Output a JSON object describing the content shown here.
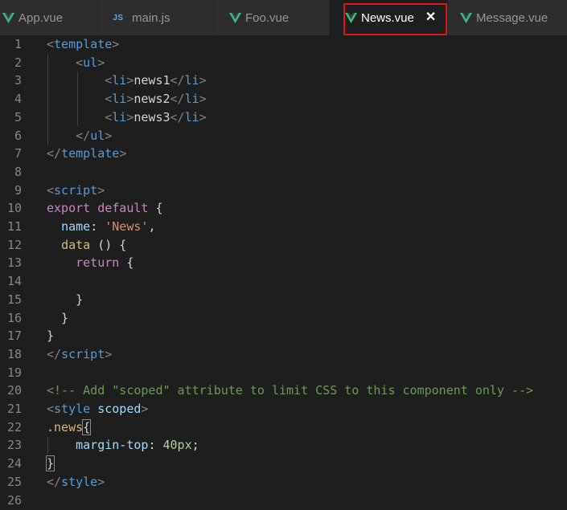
{
  "tabs": [
    {
      "label": "App.vue",
      "icon": "vue-icon",
      "active": false
    },
    {
      "label": "main.js",
      "icon": "js-icon",
      "icon_text": "JS",
      "active": false
    },
    {
      "label": "Foo.vue",
      "icon": "vue-icon",
      "active": false
    },
    {
      "label": "News.vue",
      "icon": "vue-icon",
      "active": true,
      "close": "✕"
    },
    {
      "label": "Message.vue",
      "icon": "vue-icon",
      "active": false
    }
  ],
  "colors": {
    "vue_green": "#41b883",
    "highlight_red": "#e0131a",
    "editor_bg": "#1e1e1e"
  },
  "code_lines": [
    {
      "n": "1",
      "tokens": [
        [
          "punct",
          "<"
        ],
        [
          "tag",
          "template"
        ],
        [
          "punct",
          ">"
        ]
      ]
    },
    {
      "n": "2",
      "tokens": [
        [
          "text",
          "    "
        ],
        [
          "punct",
          "<"
        ],
        [
          "tag",
          "ul"
        ],
        [
          "punct",
          ">"
        ]
      ]
    },
    {
      "n": "3",
      "tokens": [
        [
          "text",
          "        "
        ],
        [
          "punct",
          "<"
        ],
        [
          "tag",
          "li"
        ],
        [
          "punct",
          ">"
        ],
        [
          "text",
          "news1"
        ],
        [
          "punct",
          "</"
        ],
        [
          "tag",
          "li"
        ],
        [
          "punct",
          ">"
        ]
      ]
    },
    {
      "n": "4",
      "tokens": [
        [
          "text",
          "        "
        ],
        [
          "punct",
          "<"
        ],
        [
          "tag",
          "li"
        ],
        [
          "punct",
          ">"
        ],
        [
          "text",
          "news2"
        ],
        [
          "punct",
          "</"
        ],
        [
          "tag",
          "li"
        ],
        [
          "punct",
          ">"
        ]
      ]
    },
    {
      "n": "5",
      "tokens": [
        [
          "text",
          "        "
        ],
        [
          "punct",
          "<"
        ],
        [
          "tag",
          "li"
        ],
        [
          "punct",
          ">"
        ],
        [
          "text",
          "news3"
        ],
        [
          "punct",
          "</"
        ],
        [
          "tag",
          "li"
        ],
        [
          "punct",
          ">"
        ]
      ]
    },
    {
      "n": "6",
      "tokens": [
        [
          "text",
          "    "
        ],
        [
          "punct",
          "</"
        ],
        [
          "tag",
          "ul"
        ],
        [
          "punct",
          ">"
        ]
      ]
    },
    {
      "n": "7",
      "tokens": [
        [
          "punct",
          "</"
        ],
        [
          "tag",
          "template"
        ],
        [
          "punct",
          ">"
        ]
      ]
    },
    {
      "n": "8",
      "tokens": []
    },
    {
      "n": "9",
      "tokens": [
        [
          "punct",
          "<"
        ],
        [
          "tag",
          "script"
        ],
        [
          "punct",
          ">"
        ]
      ]
    },
    {
      "n": "10",
      "tokens": [
        [
          "kw",
          "export"
        ],
        [
          "text",
          " "
        ],
        [
          "kw",
          "default"
        ],
        [
          "text",
          " {"
        ]
      ]
    },
    {
      "n": "11",
      "tokens": [
        [
          "text",
          "  "
        ],
        [
          "prop",
          "name"
        ],
        [
          "text",
          ": "
        ],
        [
          "str",
          "'News'"
        ],
        [
          "text",
          ","
        ]
      ]
    },
    {
      "n": "12",
      "tokens": [
        [
          "text",
          "  "
        ],
        [
          "sel",
          "data"
        ],
        [
          "text",
          " () {"
        ]
      ]
    },
    {
      "n": "13",
      "tokens": [
        [
          "text",
          "    "
        ],
        [
          "kw",
          "return"
        ],
        [
          "text",
          " {"
        ]
      ]
    },
    {
      "n": "14",
      "tokens": []
    },
    {
      "n": "15",
      "tokens": [
        [
          "text",
          "    }"
        ]
      ]
    },
    {
      "n": "16",
      "tokens": [
        [
          "text",
          "  }"
        ]
      ]
    },
    {
      "n": "17",
      "tokens": [
        [
          "text",
          "}"
        ]
      ]
    },
    {
      "n": "18",
      "tokens": [
        [
          "punct",
          "</"
        ],
        [
          "tag",
          "script"
        ],
        [
          "punct",
          ">"
        ]
      ]
    },
    {
      "n": "19",
      "tokens": []
    },
    {
      "n": "20",
      "tokens": [
        [
          "comment",
          "<!-- Add \"scoped\" attribute to limit CSS to this component only -->"
        ]
      ]
    },
    {
      "n": "21",
      "tokens": [
        [
          "punct",
          "<"
        ],
        [
          "tag",
          "style"
        ],
        [
          "text",
          " "
        ],
        [
          "attr",
          "scoped"
        ],
        [
          "punct",
          ">"
        ]
      ]
    },
    {
      "n": "22",
      "tokens": [
        [
          "sel",
          ".news"
        ],
        [
          "box",
          "{"
        ]
      ]
    },
    {
      "n": "23",
      "tokens": [
        [
          "text",
          "    "
        ],
        [
          "prop",
          "margin-top"
        ],
        [
          "text",
          ": "
        ],
        [
          "num",
          "40px"
        ],
        [
          "text",
          ";"
        ]
      ]
    },
    {
      "n": "24",
      "tokens": [
        [
          "box",
          "}"
        ]
      ]
    },
    {
      "n": "25",
      "tokens": [
        [
          "punct",
          "</"
        ],
        [
          "tag",
          "style"
        ],
        [
          "punct",
          ">"
        ]
      ]
    },
    {
      "n": "26",
      "tokens": []
    }
  ]
}
